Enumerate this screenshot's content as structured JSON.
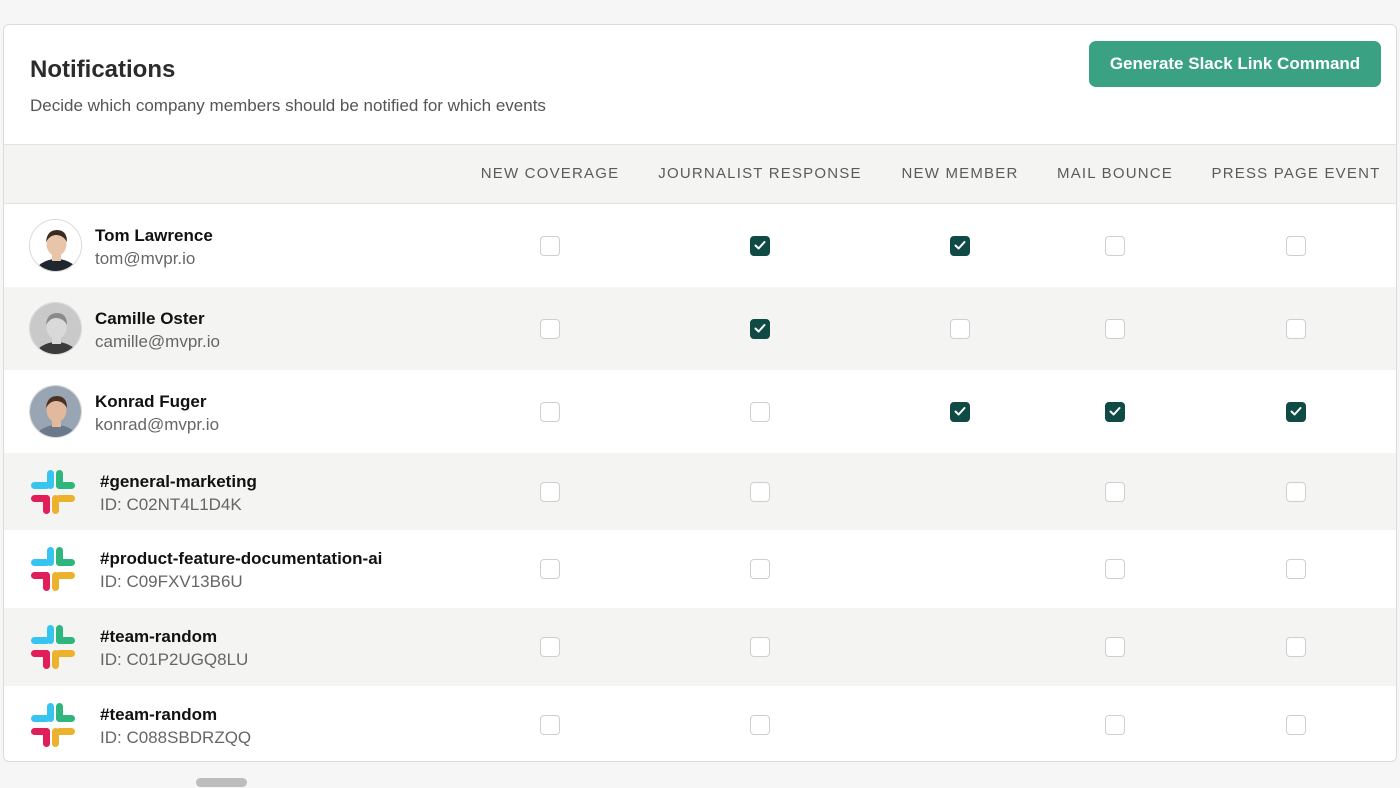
{
  "header": {
    "title": "Notifications",
    "subtitle": "Decide which company members should be notified for which events",
    "button_label": "Generate Slack Link Command"
  },
  "columns": [
    "NEW COVERAGE",
    "JOURNALIST RESPONSE",
    "NEW MEMBER",
    "MAIL BOUNCE",
    "PRESS PAGE EVENT"
  ],
  "colors": {
    "accent": "#3aa283",
    "checked": "#0f4a45"
  },
  "rows": [
    {
      "type": "member",
      "name": "Tom Lawrence",
      "sub": "tom@mvpr.io",
      "checks": [
        false,
        true,
        true,
        false,
        false
      ]
    },
    {
      "type": "member",
      "name": "Camille Oster",
      "sub": "camille@mvpr.io",
      "checks": [
        false,
        true,
        false,
        false,
        false
      ]
    },
    {
      "type": "member",
      "name": "Konrad Fuger",
      "sub": "konrad@mvpr.io",
      "checks": [
        false,
        false,
        true,
        true,
        true
      ]
    },
    {
      "type": "slack",
      "name": "#general-marketing",
      "sub": "ID: C02NT4L1D4K",
      "checks": [
        false,
        false,
        null,
        false,
        false
      ]
    },
    {
      "type": "slack",
      "name": "#product-feature-documentation-ai",
      "sub": "ID: C09FXV13B6U",
      "checks": [
        false,
        false,
        null,
        false,
        false
      ]
    },
    {
      "type": "slack",
      "name": "#team-random",
      "sub": "ID: C01P2UGQ8LU",
      "checks": [
        false,
        false,
        null,
        false,
        false
      ]
    },
    {
      "type": "slack",
      "name": "#team-random",
      "sub": "ID: C088SBDRZQQ",
      "checks": [
        false,
        false,
        null,
        false,
        false
      ]
    }
  ]
}
